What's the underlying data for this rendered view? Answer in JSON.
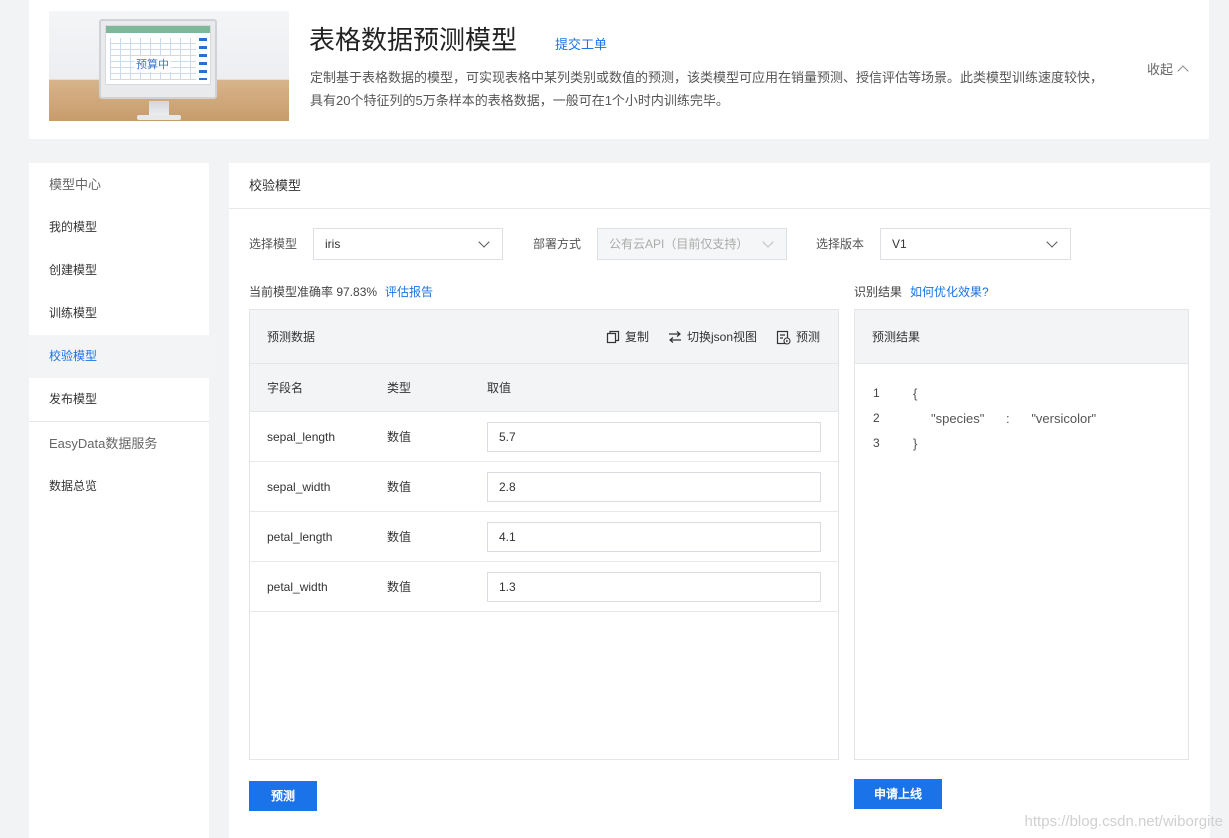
{
  "banner": {
    "image_label": "预算中",
    "title": "表格数据预测模型",
    "link": "提交工单",
    "description": "定制基于表格数据的模型，可实现表格中某列类别或数值的预测，该类模型可应用在销量预测、授信评估等场景。此类模型训练速度较快，具有20个特征列的5万条样本的表格数据，一般可在1个小时内训练完毕。",
    "collapse": "收起"
  },
  "sidebar": {
    "head": "模型中心",
    "items": [
      {
        "label": "我的模型"
      },
      {
        "label": "创建模型"
      },
      {
        "label": "训练模型"
      },
      {
        "label": "校验模型"
      },
      {
        "label": "发布模型"
      }
    ],
    "head2": "EasyData数据服务",
    "items2": [
      {
        "label": "数据总览"
      }
    ]
  },
  "main": {
    "title": "校验模型",
    "model_label": "选择模型",
    "model_value": "iris",
    "deploy_label": "部署方式",
    "deploy_value": "公有云API（目前仅支持）",
    "version_label": "选择版本",
    "version_value": "V1",
    "accuracy_text": "当前模型准确率 97.83%",
    "report_link": "评估报告",
    "result_label": "识别结果",
    "optimize_link": "如何优化效果?"
  },
  "predict_panel": {
    "title": "预测数据",
    "copy": "复制",
    "json_view": "切换json视图",
    "predict_tool": "预测",
    "columns": [
      "字段名",
      "类型",
      "取值"
    ],
    "rows": [
      {
        "field": "sepal_length",
        "type": "数值",
        "value": "5.7"
      },
      {
        "field": "sepal_width",
        "type": "数值",
        "value": "2.8"
      },
      {
        "field": "petal_length",
        "type": "数值",
        "value": "4.1"
      },
      {
        "field": "petal_width",
        "type": "数值",
        "value": "1.3"
      }
    ]
  },
  "result_panel": {
    "title": "预测结果",
    "lines": [
      {
        "n": "1",
        "text": "{"
      },
      {
        "n": "2",
        "text": "     \"species\"      :      \"versicolor\""
      },
      {
        "n": "3",
        "text": "}"
      }
    ]
  },
  "buttons": {
    "predict": "预测",
    "publish": "申请上线"
  },
  "watermark": "https://blog.csdn.net/wiborgite",
  "colors": {
    "accent": "#1a73e8",
    "page_bg": "#f2f3f5",
    "panel_head": "#f3f4f6"
  }
}
